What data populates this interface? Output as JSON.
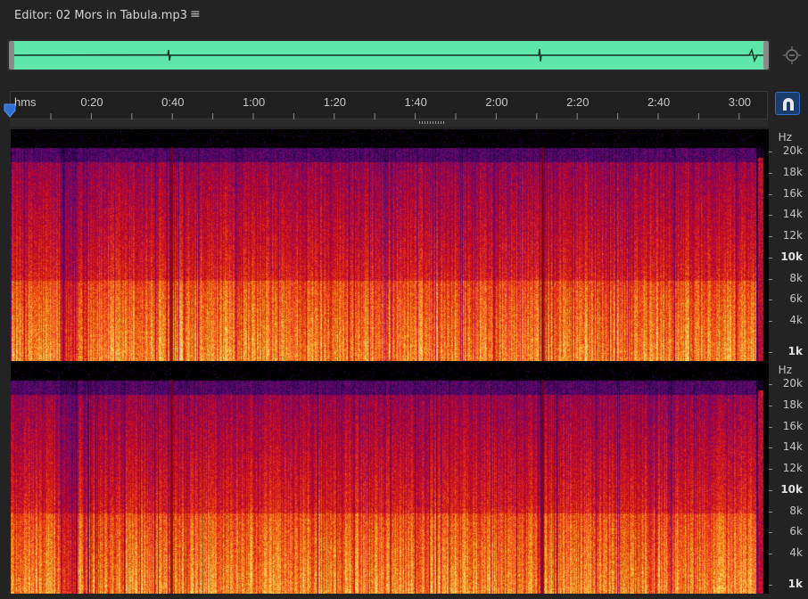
{
  "header": {
    "title": "Editor: 02 Mors in Tabula.mp3",
    "menu_icon": "hamburger-menu-icon"
  },
  "overview": {
    "waveform_color": "#5fe6ab"
  },
  "ruler": {
    "unit_label": "hms",
    "labels": [
      "0:20",
      "0:40",
      "1:00",
      "1:20",
      "1:40",
      "2:00",
      "2:20",
      "2:40",
      "3:00"
    ]
  },
  "frequency_axis": {
    "unit": "Hz",
    "labels": [
      "20k",
      "18k",
      "16k",
      "14k",
      "12k",
      "10k",
      "8k",
      "6k",
      "4k",
      "1k"
    ]
  },
  "colors": {
    "accent": "#2f6fd0",
    "background": "#232323"
  }
}
